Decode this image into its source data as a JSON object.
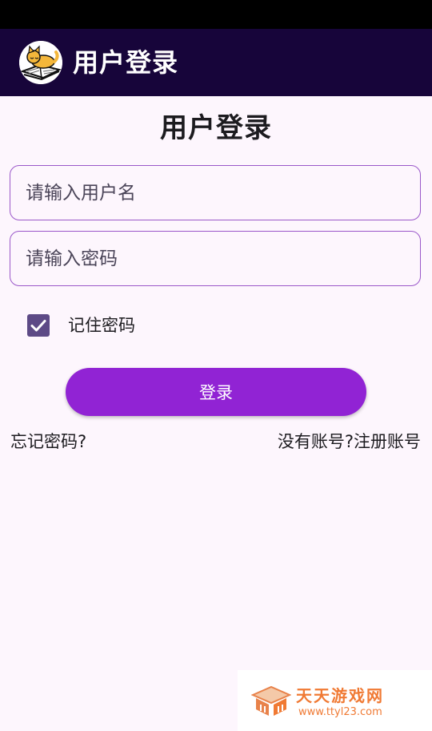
{
  "app_bar": {
    "title": "用户登录",
    "logo_icon": "cat-on-book-icon",
    "background": "#17053a"
  },
  "page": {
    "title": "用户登录"
  },
  "form": {
    "username": {
      "value": "",
      "placeholder": "请输入用户名"
    },
    "password": {
      "value": "",
      "placeholder": "请输入密码"
    },
    "remember": {
      "label": "记住密码",
      "checked": true
    },
    "login_label": "登录",
    "forgot_label": "忘记密码?",
    "register_label": "没有账号?注册账号"
  },
  "watermark": {
    "title": "天天游戏网",
    "url": "www.ttyl23.com"
  },
  "colors": {
    "accent": "#9123d4",
    "field_border": "#9a57c9",
    "checkbox": "#5d4a86",
    "background": "#fdf6fd",
    "watermark": "#f07a34"
  }
}
